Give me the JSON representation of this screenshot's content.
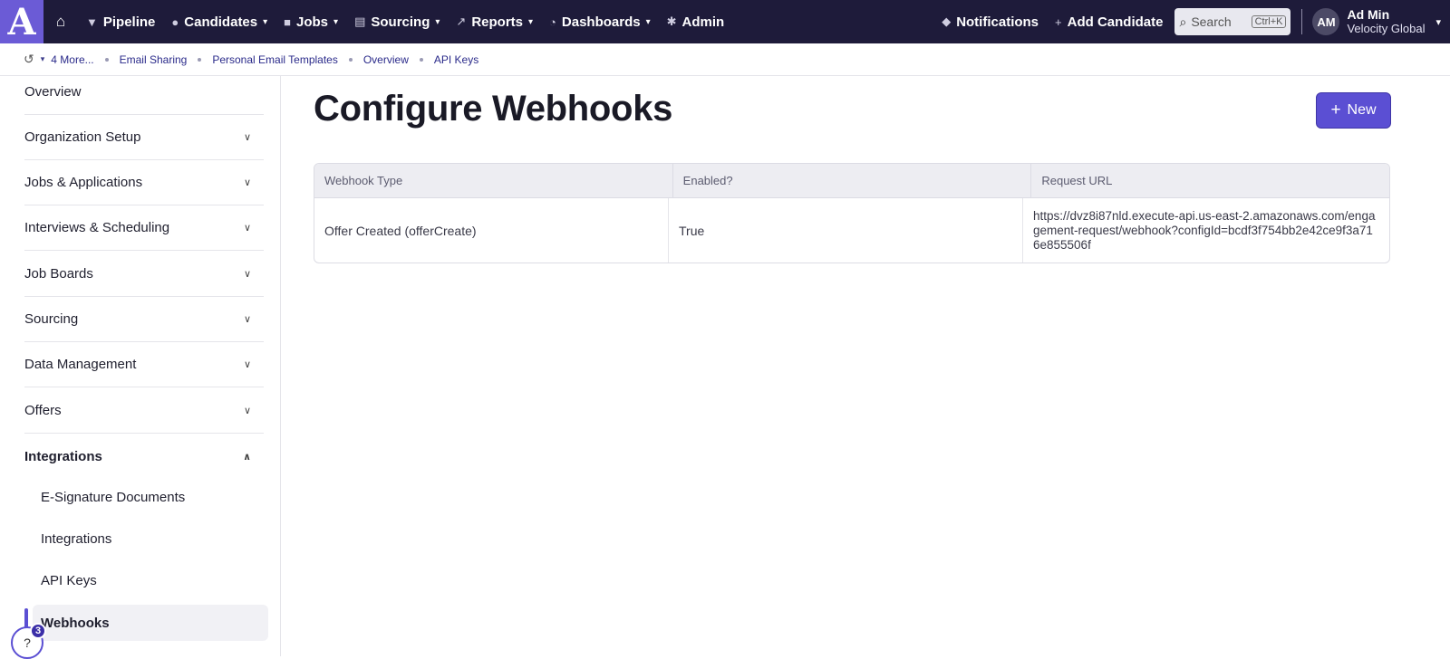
{
  "brand": {
    "logo_letter": "A",
    "accent": "#5b4fd3",
    "nav_bg": "#1e1b3a"
  },
  "topnav": {
    "items": [
      {
        "label": "Pipeline",
        "icon": "funnel-icon",
        "has_dropdown": false
      },
      {
        "label": "Candidates",
        "icon": "people-icon",
        "has_dropdown": true
      },
      {
        "label": "Jobs",
        "icon": "briefcase-icon",
        "has_dropdown": true
      },
      {
        "label": "Sourcing",
        "icon": "sourcing-icon",
        "has_dropdown": true
      },
      {
        "label": "Reports",
        "icon": "chart-icon",
        "has_dropdown": true
      },
      {
        "label": "Dashboards",
        "icon": "gauge-icon",
        "has_dropdown": true
      },
      {
        "label": "Admin",
        "icon": "gear-icon",
        "has_dropdown": false
      }
    ],
    "notifications_label": "Notifications",
    "add_candidate_label": "Add Candidate",
    "search_placeholder": "Search",
    "search_shortcut": "Ctrl+K",
    "user": {
      "initials": "AM",
      "name": "Ad Min",
      "org": "Velocity Global"
    }
  },
  "breadcrumb": {
    "more_label": "4 More...",
    "items": [
      "Email Sharing",
      "Personal Email Templates",
      "Overview",
      "API Keys"
    ]
  },
  "sidebar": {
    "sections": [
      {
        "label": "Overview",
        "expandable": false
      },
      {
        "label": "Organization Setup",
        "expandable": true
      },
      {
        "label": "Jobs & Applications",
        "expandable": true
      },
      {
        "label": "Interviews & Scheduling",
        "expandable": true
      },
      {
        "label": "Job Boards",
        "expandable": true
      },
      {
        "label": "Sourcing",
        "expandable": true
      },
      {
        "label": "Data Management",
        "expandable": true
      },
      {
        "label": "Offers",
        "expandable": true
      },
      {
        "label": "Integrations",
        "expandable": true,
        "expanded": true
      }
    ],
    "sub_items": [
      "E-Signature Documents",
      "Integrations",
      "API Keys",
      "Webhooks"
    ],
    "active_item": "Webhooks",
    "help_badge_count": "3",
    "help_label": "?"
  },
  "main": {
    "title": "Configure Webhooks",
    "new_button_label": "New",
    "table": {
      "headers": [
        "Webhook Type",
        "Enabled?",
        "Request URL"
      ],
      "rows": [
        [
          "Offer Created (offerCreate)",
          "True",
          "https://dvz8i87nld.execute-api.us-east-2.amazonaws.com/engagement-request/webhook?configId=bcdf3f754bb2e42ce9f3a716e855506f"
        ]
      ]
    }
  }
}
